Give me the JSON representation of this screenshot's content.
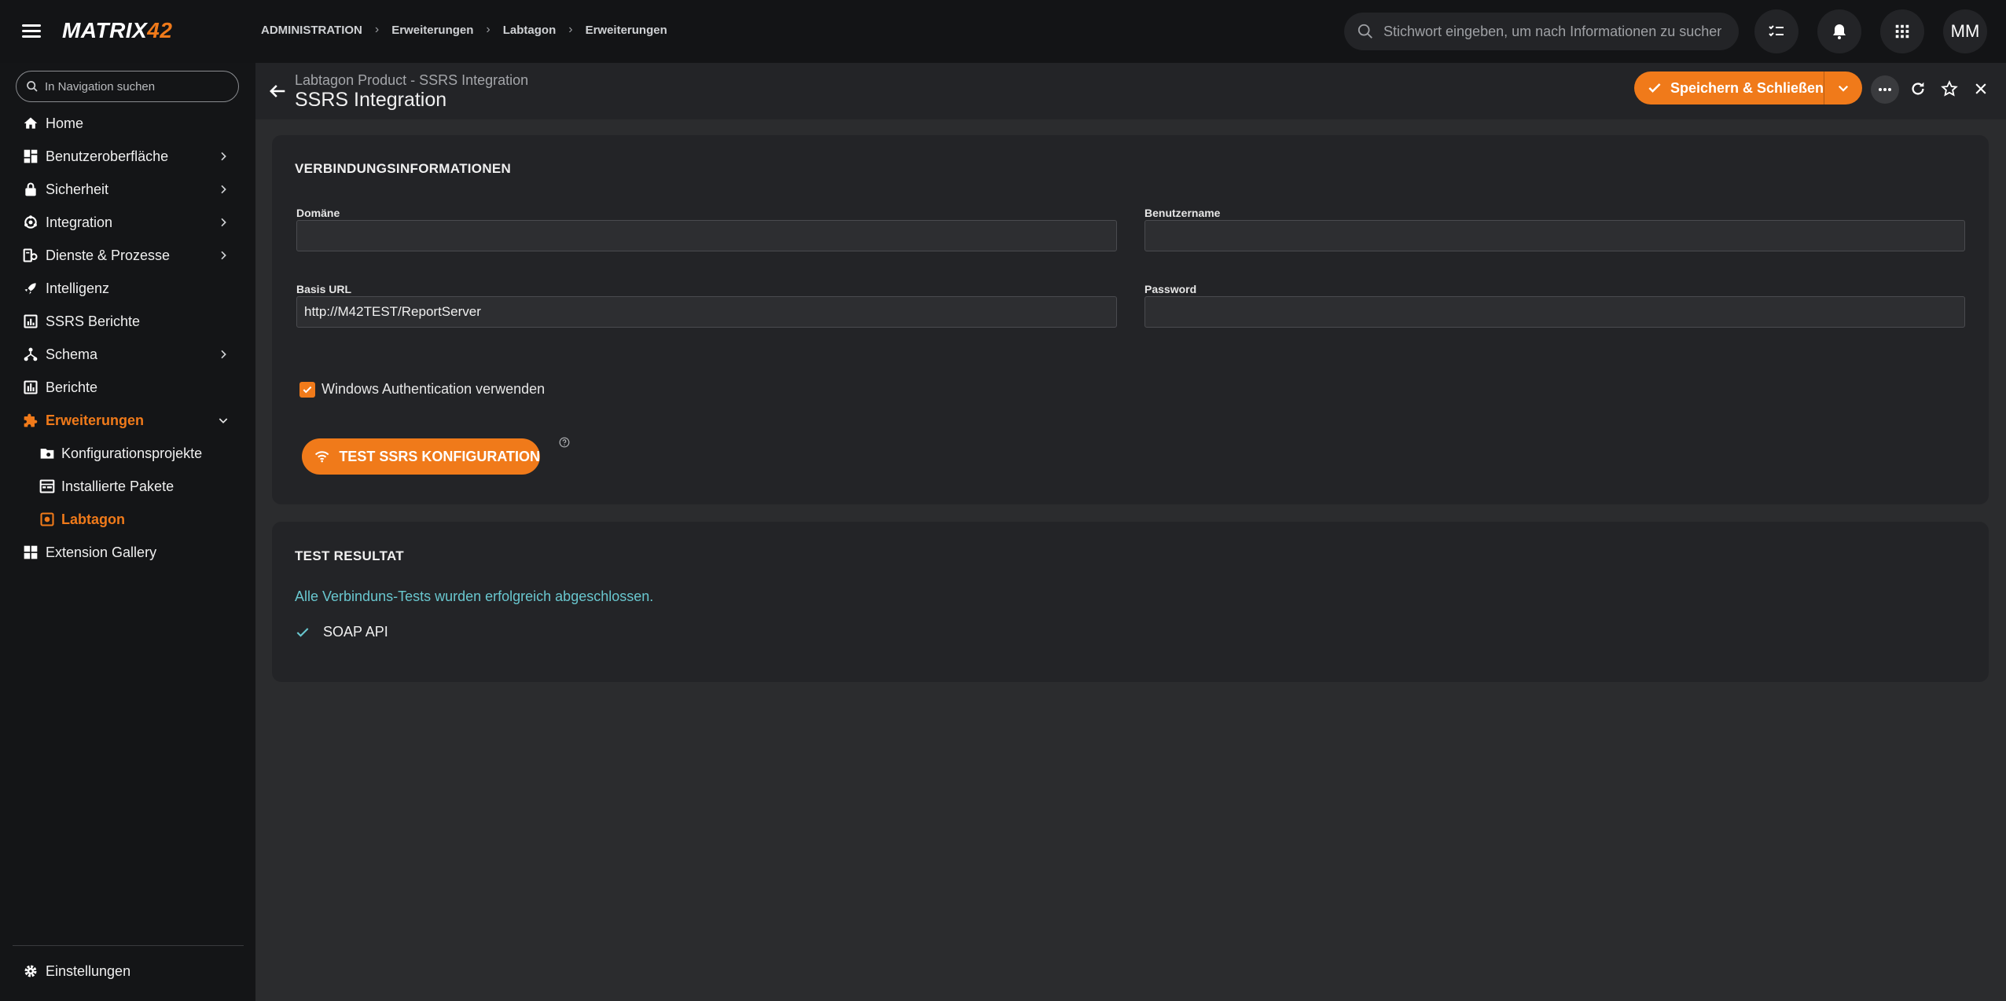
{
  "app": {
    "logo_main": "MATRIX",
    "logo_accent": "42",
    "avatar_initials": "MM"
  },
  "breadcrumb": [
    "ADMINISTRATION",
    "Erweiterungen",
    "Labtagon",
    "Erweiterungen"
  ],
  "top_search": {
    "placeholder": "Stichwort eingeben, um nach Informationen zu suchen"
  },
  "nav_search": {
    "placeholder": "In Navigation suchen"
  },
  "sidebar": {
    "items": [
      {
        "label": "Home",
        "icon": "home-icon"
      },
      {
        "label": "Benutzeroberfläche",
        "icon": "dashboard-icon"
      },
      {
        "label": "Sicherheit",
        "icon": "lock-icon"
      },
      {
        "label": "Integration",
        "icon": "integration-icon"
      },
      {
        "label": "Dienste & Prozesse",
        "icon": "services-icon"
      },
      {
        "label": "Intelligenz",
        "icon": "rocket-icon"
      },
      {
        "label": "SSRS Berichte",
        "icon": "report-chart-icon"
      },
      {
        "label": "Schema",
        "icon": "schema-icon"
      },
      {
        "label": "Berichte",
        "icon": "bar-chart-icon"
      },
      {
        "label": "Erweiterungen",
        "icon": "puzzle-icon"
      },
      {
        "label": "Konfigurationsprojekte",
        "icon": "folder-gear-icon"
      },
      {
        "label": "Installierte Pakete",
        "icon": "package-icon"
      },
      {
        "label": "Labtagon",
        "icon": "extension-icon"
      },
      {
        "label": "Extension Gallery",
        "icon": "gallery-icon"
      }
    ],
    "settings_label": "Einstellungen"
  },
  "header": {
    "subtitle": "Labtagon Product - SSRS Integration",
    "title": "SSRS Integration",
    "save_label": "Speichern & Schließen"
  },
  "connection": {
    "title": "VERBINDUNGSINFORMATIONEN",
    "domain_label": "Domäne",
    "domain_value": "",
    "username_label": "Benutzername",
    "username_value": "",
    "baseurl_label": "Basis URL",
    "baseurl_value": "http://M42TEST/ReportServer",
    "password_label": "Password",
    "password_value": "",
    "windows_auth_label": "Windows Authentication verwenden",
    "windows_auth_checked": true,
    "test_button_label": "TEST SSRS KONFIGURATION"
  },
  "result": {
    "title": "TEST RESULTAT",
    "message": "Alle Verbinduns-Tests wurden erfolgreich abgeschlossen.",
    "items": [
      "SOAP API"
    ]
  },
  "colors": {
    "accent": "#f07a1a",
    "success_text": "#69c7cf",
    "sidebar_bg": "#141517",
    "card_bg": "#232427"
  }
}
